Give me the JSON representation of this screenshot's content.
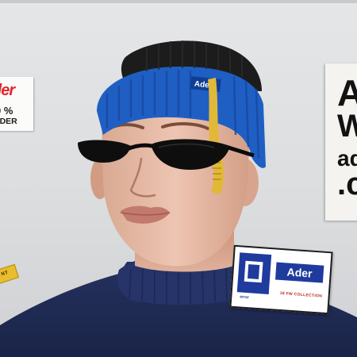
{
  "left_sticker": {
    "brand": "der",
    "percent": "0 %",
    "maker": "ADER"
  },
  "right_poster": {
    "lines": [
      "A",
      "W",
      "ad",
      ".c"
    ]
  },
  "left_tag": {
    "text": "NT"
  },
  "beanie": {
    "label": "Ader"
  },
  "bottom_right_sticker": {
    "brand": "Ader",
    "collection": "18 FW COLLECTION",
    "sub": "error"
  },
  "colors": {
    "background": "#dcdddf",
    "beanie_blue": "#1f5fc4",
    "beanie_black": "#1c1c1c",
    "sweater_navy": "#1e2a52",
    "sticker_blue": "#1f3b9e",
    "tag_yellow": "#e8bd2e"
  }
}
